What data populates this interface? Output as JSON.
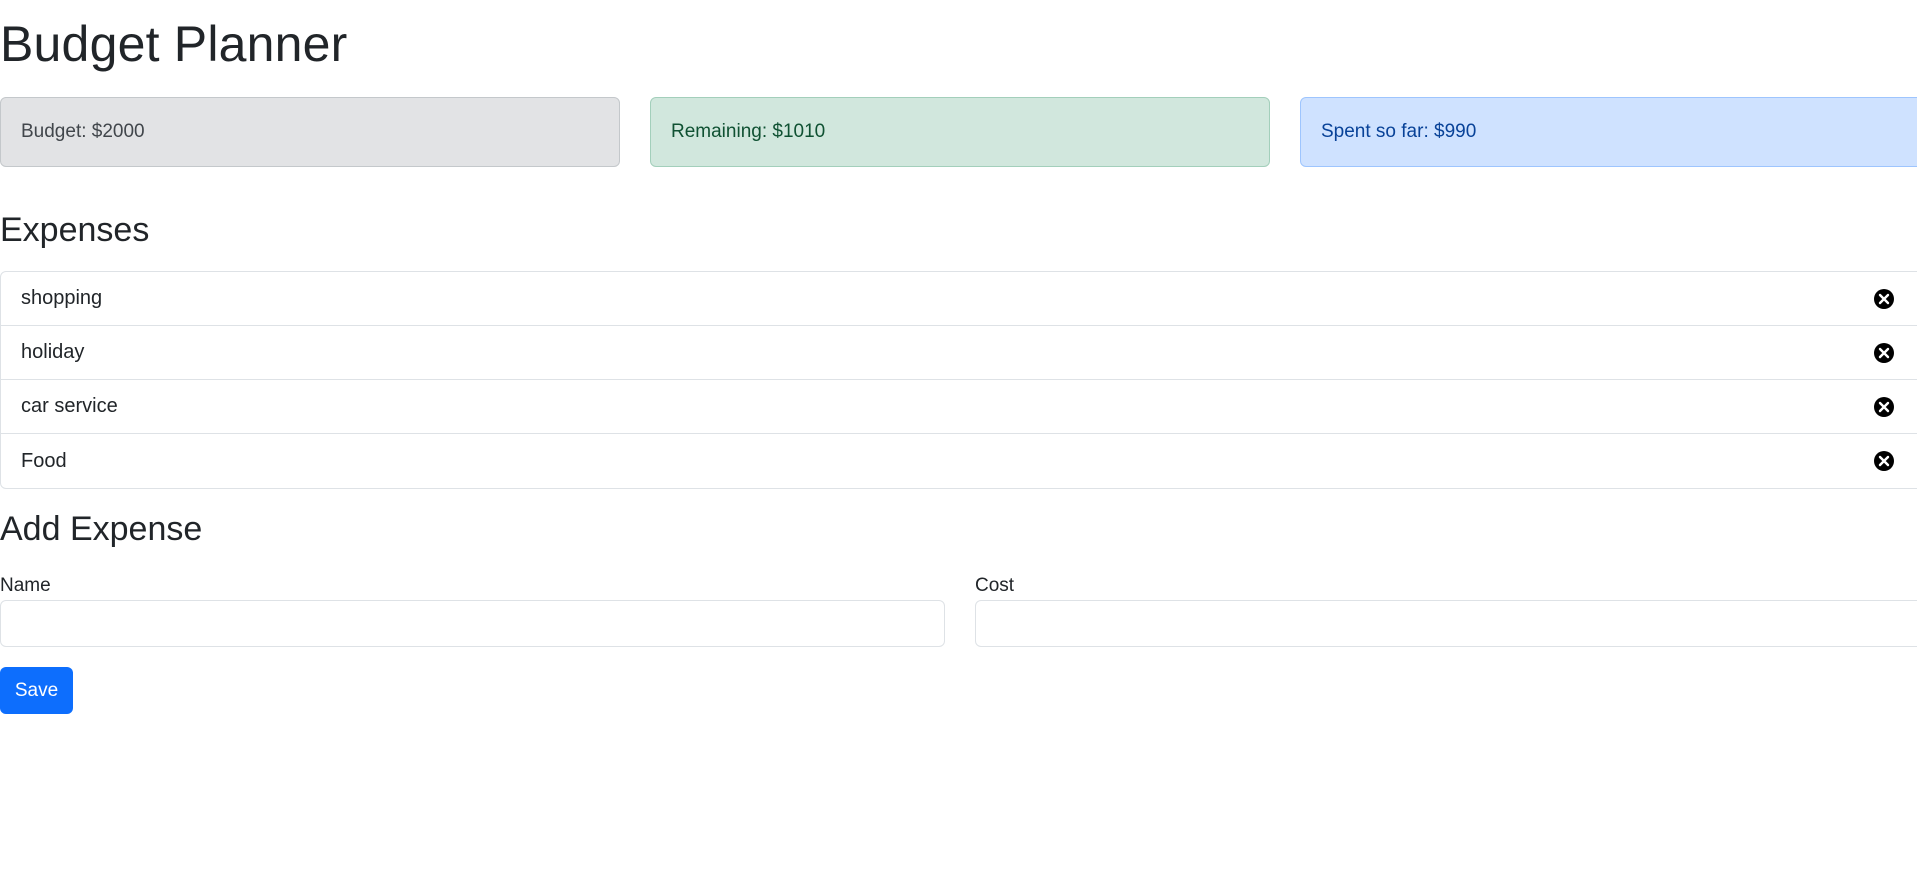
{
  "header": {
    "title": "Budget Planner"
  },
  "summary": {
    "budget": "Budget: $2000",
    "remaining": "Remaining: $1010",
    "spent": "Spent so far: $990"
  },
  "expenses": {
    "heading": "Expenses",
    "items": [
      {
        "name": "shopping",
        "icon": "close-circle-icon"
      },
      {
        "name": "holiday",
        "icon": "close-circle-icon"
      },
      {
        "name": "car service",
        "icon": "close-circle-icon"
      },
      {
        "name": "Food",
        "icon": "close-circle-icon"
      }
    ]
  },
  "add_expense": {
    "heading": "Add Expense",
    "name_label": "Name",
    "name_value": "",
    "cost_label": "Cost",
    "cost_value": "",
    "save_label": "Save"
  },
  "colors": {
    "primary": "#0d6efd",
    "budget_bg": "#e2e3e5",
    "remaining_bg": "#d1e7dd",
    "spent_bg": "#cfe2ff"
  }
}
